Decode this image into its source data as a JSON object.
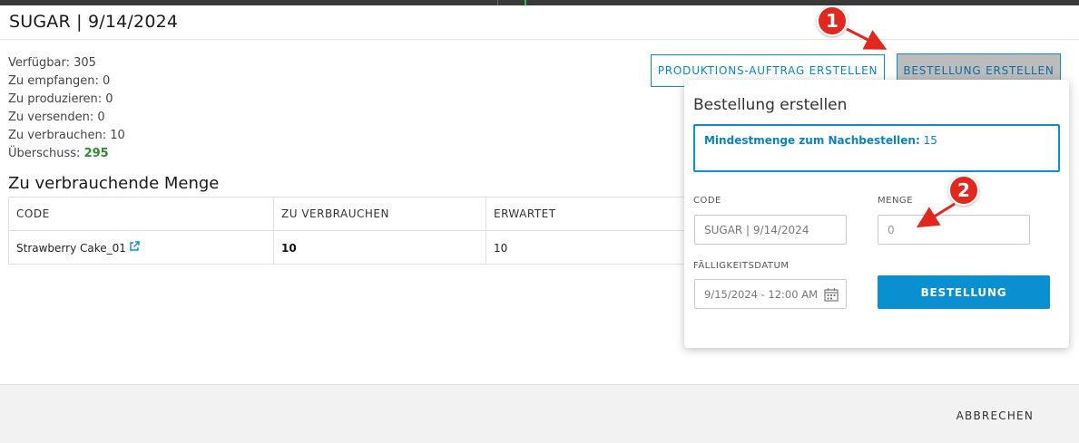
{
  "modal": {
    "title": "SUGAR | 9/14/2024"
  },
  "stats": {
    "available": "Verfügbar: 305",
    "to_receive": "Zu empfangen: 0",
    "to_produce": "Zu produzieren: 0",
    "to_ship": "Zu versenden: 0",
    "to_consume": "Zu verbrauchen: 10",
    "surplus_label": "Überschuss: ",
    "surplus_value": "295"
  },
  "consumption": {
    "title": "Zu verbrauchende Menge",
    "columns": [
      "CODE",
      "ZU VERBRAUCHEN",
      "ERWARTET"
    ],
    "rows": [
      {
        "code": "Strawberry Cake_01",
        "to_consume": "10",
        "expected": "10"
      }
    ]
  },
  "actions": {
    "production_order_label": "PRODUKTIONS-AUFTRAG ERSTELLEN",
    "create_order_label": "BESTELLUNG ERSTELLEN"
  },
  "popover": {
    "title": "Bestellung erstellen",
    "min_qty_label": "Mindestmenge zum Nachbestellen:",
    "min_qty_value": "15",
    "code_label": "CODE",
    "code_value": "SUGAR | 9/14/2024",
    "qty_label": "MENGE",
    "qty_placeholder": "0",
    "due_label": "FÄLLIGKEITSDATUM",
    "due_value": "9/15/2024 - 12:00 AM",
    "submit_label": "BESTELLUNG"
  },
  "footer": {
    "cancel_label": "ABBRECHEN"
  },
  "annotations": {
    "marker1": "1",
    "marker2": "2"
  },
  "colors": {
    "accent": "#0a8fd0",
    "surplus": "#2e8b2e",
    "marker": "#e0281e"
  }
}
